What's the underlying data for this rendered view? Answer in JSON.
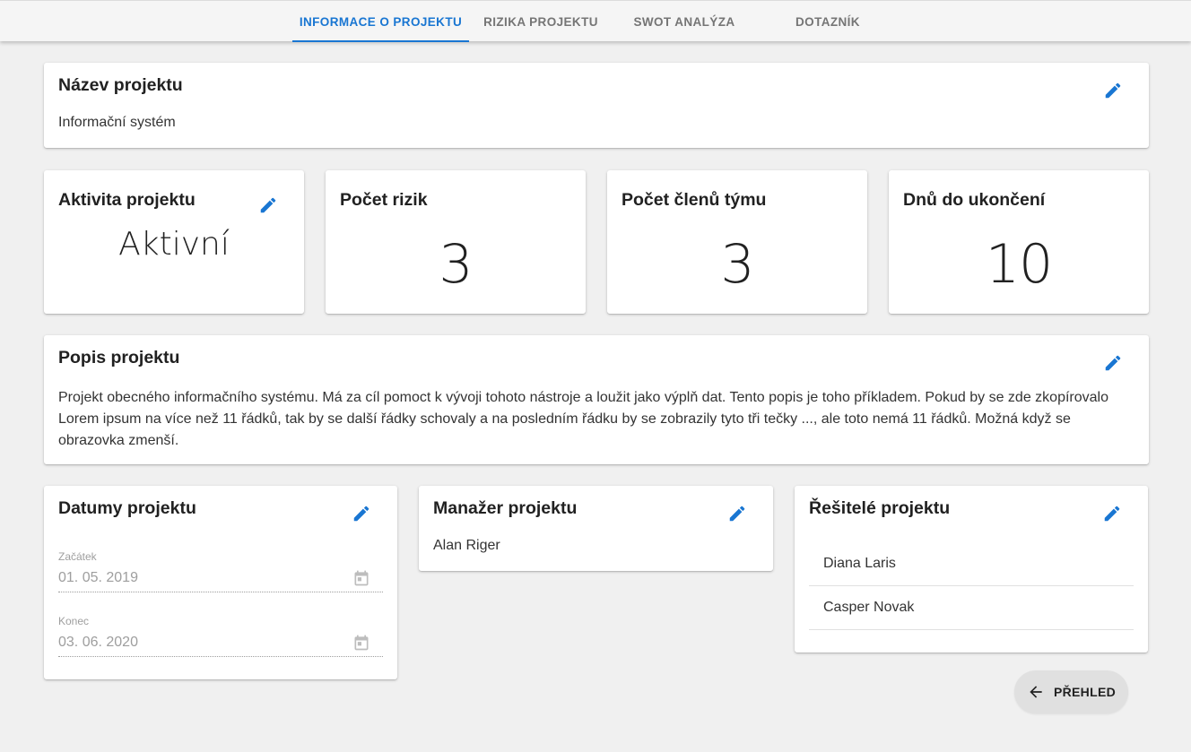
{
  "tabs": [
    {
      "label": "INFORMACE O PROJEKTU",
      "active": true
    },
    {
      "label": "RIZIKA PROJEKTU",
      "active": false
    },
    {
      "label": "SWOT ANALÝZA",
      "active": false
    },
    {
      "label": "DOTAZNÍK",
      "active": false
    }
  ],
  "project_name": {
    "title": "Název projektu",
    "value": "Informační systém"
  },
  "stats": {
    "activity": {
      "title": "Aktivita projektu",
      "value": "Aktivní"
    },
    "risk_count": {
      "title": "Počet rizik",
      "value": "3"
    },
    "team_count": {
      "title": "Počet členů týmu",
      "value": "3"
    },
    "days_left": {
      "title": "Dnů do ukončení",
      "value": "10"
    }
  },
  "description": {
    "title": "Popis projektu",
    "text": "Projekt obecného informačního systému. Má za cíl pomoct k vývoji tohoto nástroje a loužit jako výplň dat. Tento popis je toho příkladem. Pokud by se zde zkopírovalo Lorem ipsum na více než 11 řádků, tak by se další řádky schovaly a na posledním řádku by se zobrazily tyto tři tečky ..., ale toto nemá 11 řádků. Možná když se obrazovka zmenší."
  },
  "dates": {
    "title": "Datumy projektu",
    "start_label": "Začátek",
    "start_value": "01. 05. 2019",
    "end_label": "Konec",
    "end_value": "03. 06. 2020"
  },
  "manager": {
    "title": "Manažer projektu",
    "name": "Alan Riger"
  },
  "solvers": {
    "title": "Řešitelé projektu",
    "items": [
      "Diana Laris",
      "Casper Novak"
    ]
  },
  "back_button": {
    "label": "PŘEHLED"
  },
  "colors": {
    "accent": "#1976d2",
    "background": "#f0f0f0",
    "card": "#ffffff"
  },
  "icons": {
    "edit": "pencil-icon",
    "calendar": "calendar-icon",
    "back": "arrow-left-icon"
  }
}
